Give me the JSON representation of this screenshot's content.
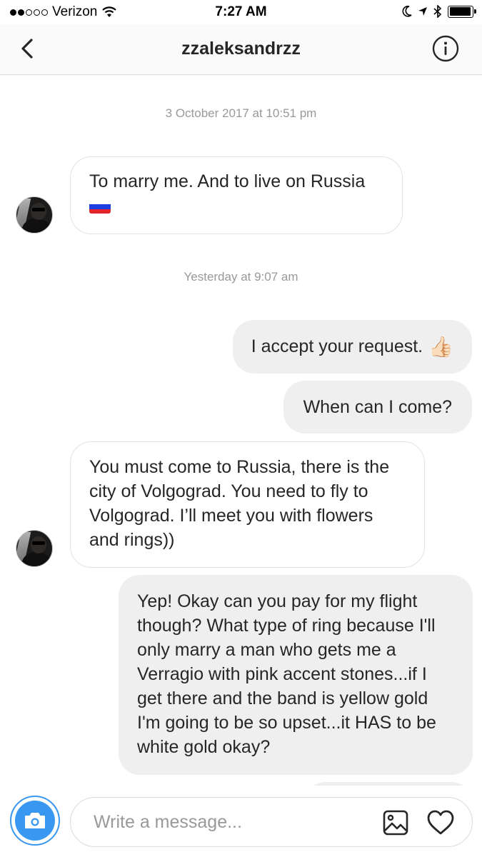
{
  "status_bar": {
    "carrier": "Verizon",
    "time": "7:27 AM",
    "signal_bars_filled": 2,
    "signal_bars_total": 5,
    "battery_level": 0.95
  },
  "header": {
    "title": "zzaleksandrzz",
    "back_icon": "chevron-left-icon",
    "info_icon": "info-circle-icon"
  },
  "thread": {
    "timestamp_1": "3 October 2017 at 10:51 pm",
    "timestamp_2": "Yesterday at 9:07 am",
    "messages": [
      {
        "direction": "incoming",
        "text": "To marry me. And to live on Russia",
        "emoji": "flag-russia"
      },
      {
        "direction": "outgoing",
        "text": "I accept your request.",
        "emoji": "👍🏻"
      },
      {
        "direction": "outgoing",
        "text": "When can I come?"
      },
      {
        "direction": "incoming",
        "text": "You must come to Russia, there is the city of Volgograd. You need to fly to Volgograd. I’ll meet you with flowers and rings))"
      },
      {
        "direction": "outgoing",
        "text": "Yep! Okay can you pay for my flight though? What type of ring because I'll only marry a man who gets me a Verragio with pink accent stones...if I get there and the band is yellow gold I'm going to be so upset...it HAS to be white gold okay?"
      }
    ]
  },
  "composer": {
    "placeholder": "Write a message...",
    "value": "",
    "camera_icon": "camera-icon",
    "gallery_icon": "image-icon",
    "like_icon": "heart-icon"
  },
  "colors": {
    "accent": "#3897f0",
    "incoming_bubble": "#ffffff",
    "outgoing_bubble": "#efefef",
    "timestamp": "#999999",
    "flag": [
      "#ffffff",
      "#1c3ee0",
      "#e4262c"
    ]
  }
}
